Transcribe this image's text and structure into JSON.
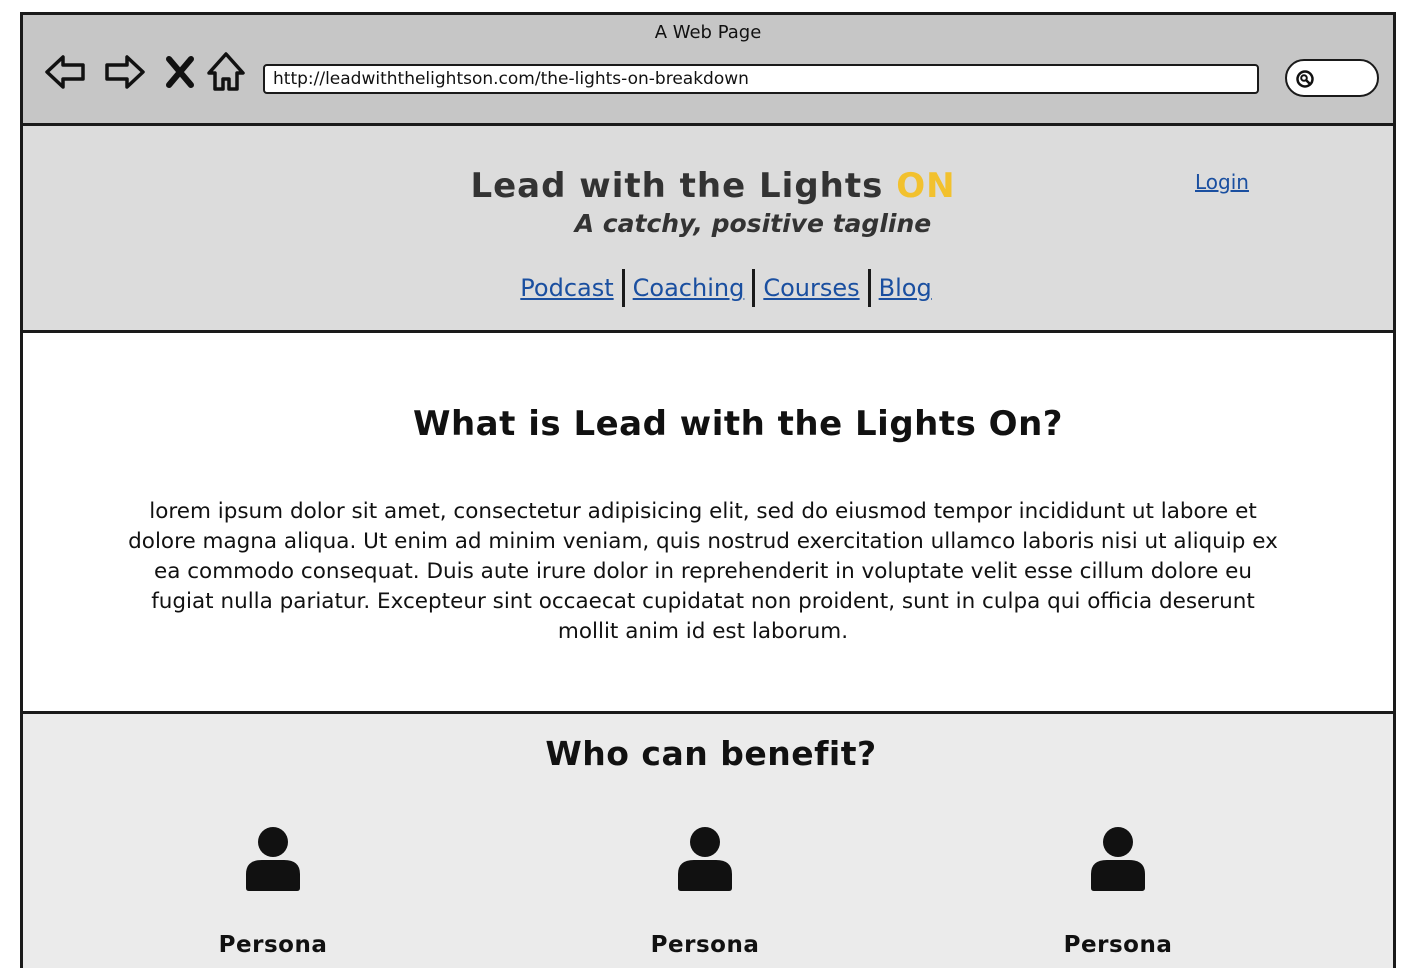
{
  "window": {
    "title": "A Web Page",
    "url": "http://leadwiththelightson.com/the-lights-on-breakdown"
  },
  "toolbar": {
    "icons": [
      "back-arrow-icon",
      "forward-arrow-icon",
      "close-x-icon",
      "home-icon",
      "search-icon"
    ]
  },
  "header": {
    "brand_main": "Lead with the Lights",
    "brand_accent": "ON",
    "tagline": "A catchy, positive tagline",
    "login_label": "Login",
    "nav": [
      "Podcast",
      "Coaching",
      "Courses",
      "Blog"
    ]
  },
  "intro": {
    "heading": "What is Lead with the Lights On?",
    "body": "lorem ipsum dolor sit amet, consectetur adipisicing elit, sed do eiusmod tempor incididunt ut labore et dolore magna aliqua. Ut enim ad minim veniam, quis nostrud exercitation ullamco laboris nisi ut aliquip ex ea commodo consequat. Duis aute irure dolor in reprehenderit in voluptate velit esse cillum dolore eu fugiat nulla pariatur. Excepteur sint occaecat cupidatat non proident, sunt in culpa qui officia deserunt mollit anim id est laborum."
  },
  "benefit": {
    "heading": "Who can benefit?",
    "personas": [
      {
        "label": "Persona",
        "icon": "user-icon"
      },
      {
        "label": "Persona",
        "icon": "user-icon"
      },
      {
        "label": "Persona",
        "icon": "user-icon"
      }
    ]
  },
  "colors": {
    "accent": "#f2c12e",
    "link": "#1a4fa0",
    "chrome": "#c6c6c6",
    "header_bg": "#dcdcdc",
    "section_bg": "#ebebeb"
  }
}
